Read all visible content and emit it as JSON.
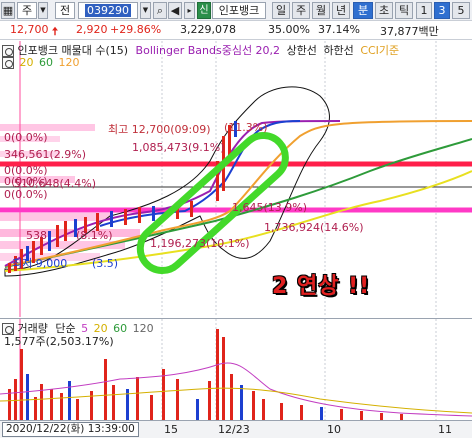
{
  "toolbar": {
    "type_label": "주",
    "type2_label": "전",
    "code": "039290",
    "stock_name": "인포뱅크",
    "periods": [
      "일",
      "주",
      "월",
      "년",
      "분",
      "초",
      "틱"
    ],
    "active_period": "분",
    "num1": "1",
    "num2": "3",
    "num3": "5"
  },
  "info": {
    "price": "12,700",
    "change": "2,920",
    "change_pct": "+29.86%",
    "volume": "3,229,078",
    "ratio": "35.00%",
    "ratio2": "37.14%",
    "amount": "37,877백만"
  },
  "price_pane": {
    "title": "인포뱅크 매물대 수(15)",
    "indicator_label": "Bollinger Bands중심선 20,2",
    "upper_label": "상한선",
    "lower_label": "하한선",
    "cci_label": "CCI기준",
    "ma_labels": [
      "20",
      "60",
      "120"
    ],
    "annotations": {
      "high": "최고 12,700(09:09)",
      "high_pct": "(11.3%)",
      "a1": "0(0.0%)",
      "a2": "346,561(2.9%)",
      "a3": "1,085,473(9.1%)",
      "a4": "0(0.0%)",
      "a5": "0(0.0%)",
      "a6": "510,648(4.4%)",
      "a7": "0(0.0%)",
      "a8": "1,645(13.9%)",
      "a9": "538",
      "a10": "(8.1%)",
      "a11": "1,736,924(14.6%)",
      "a12": "1,196,273(10.1%)",
      "a13": "최저 9,000",
      "a14": "(3.5)",
      "a15": "0(0.0%)"
    },
    "overlay_text": "2 연상 !!"
  },
  "volume_pane": {
    "title": "거래량",
    "ma_label": "단순",
    "ma_values": [
      "5",
      "20",
      "60",
      "120"
    ],
    "max_label": "1,577주(2,503.17%)"
  },
  "x_axis": {
    "cursor_date": "2020/12/22(화) 13:39:00",
    "ticks": [
      "15",
      "12/23",
      "10",
      "11"
    ]
  },
  "colors": {
    "up": "#e0241b",
    "down": "#1c3fd0",
    "ma20": "#d4b000",
    "ma60": "#2e9b3a",
    "ma120": "#f0a030",
    "bb_mid": "#9a1fb0",
    "highlight": "#43d92a",
    "band_pink": "#ff39c6",
    "band_red": "#ff1f4a"
  },
  "icons": [
    "settings-icon",
    "arrow-up-icon",
    "search-icon",
    "speaker-icon",
    "stock-badge-icon",
    "dropdown-icon"
  ]
}
